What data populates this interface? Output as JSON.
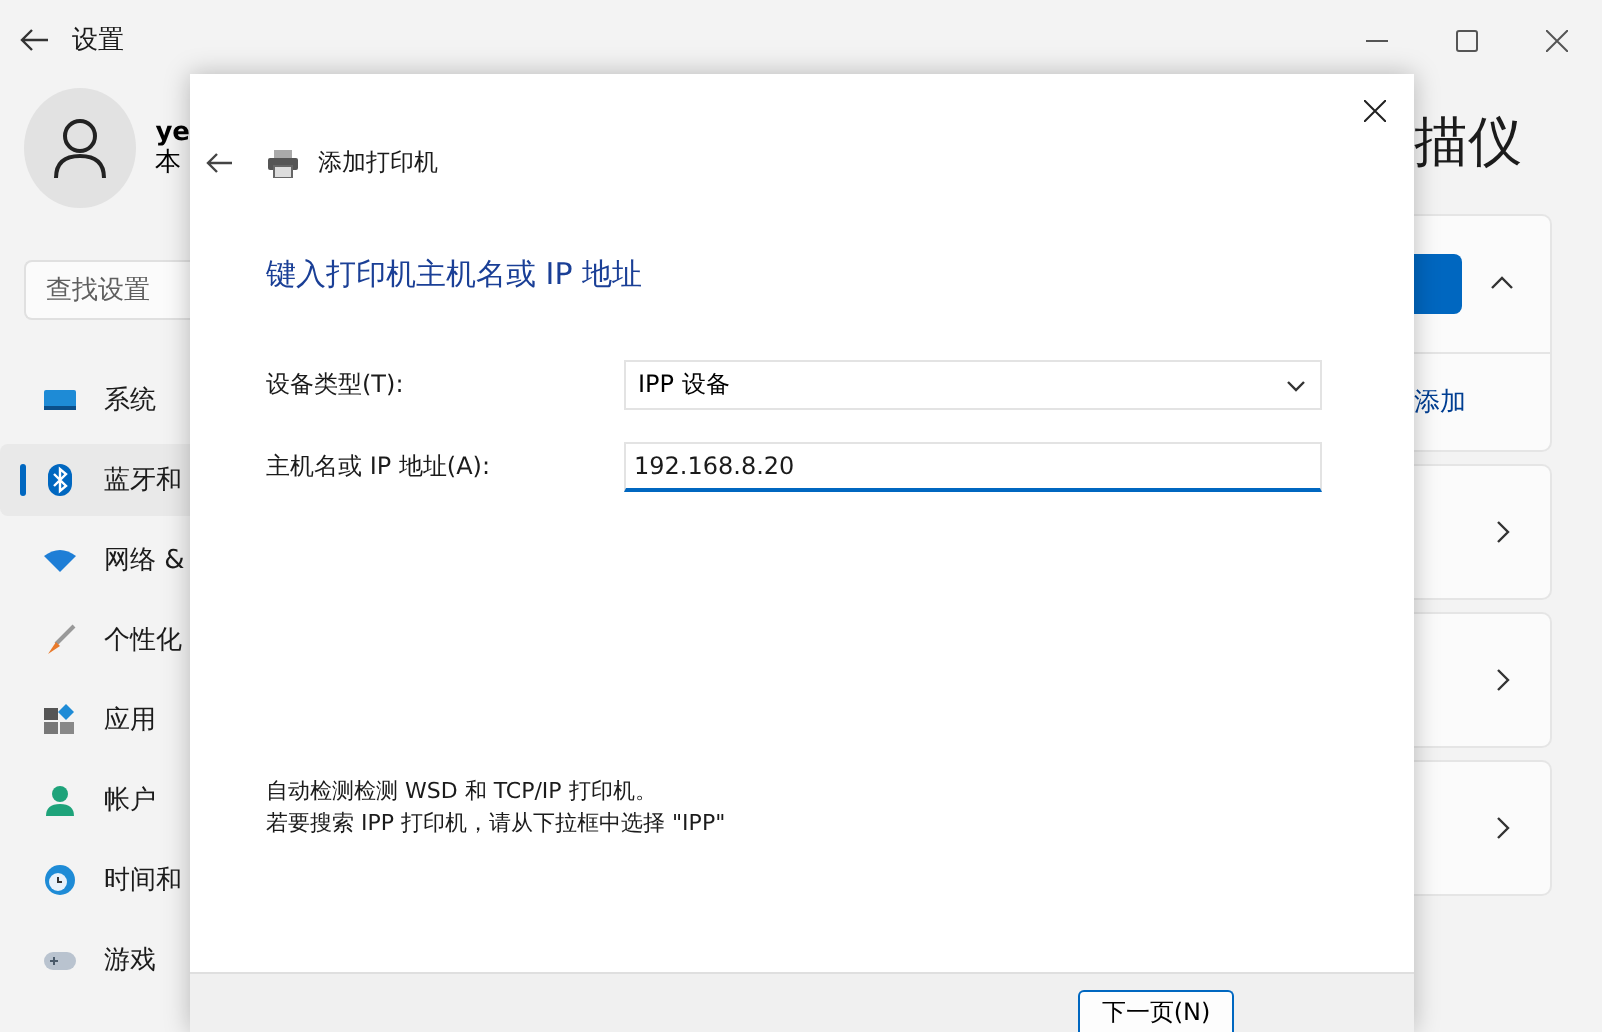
{
  "window": {
    "title": "设置"
  },
  "profile": {
    "name": "ye",
    "subtitle": "本"
  },
  "search": {
    "placeholder": "查找设置"
  },
  "sidebar": {
    "items": [
      {
        "label": "系统",
        "selected": false
      },
      {
        "label": "蓝牙和",
        "selected": true
      },
      {
        "label": "网络 &",
        "selected": false
      },
      {
        "label": "个性化",
        "selected": false
      },
      {
        "label": "应用",
        "selected": false
      },
      {
        "label": "帐户",
        "selected": false
      },
      {
        "label": "时间和",
        "selected": false
      },
      {
        "label": "游戏",
        "selected": false
      }
    ]
  },
  "page": {
    "title": "描仪",
    "cards": [
      {
        "kind": "expanded",
        "link": "添加"
      },
      {
        "kind": "collapsed"
      },
      {
        "kind": "collapsed"
      },
      {
        "kind": "collapsed"
      }
    ]
  },
  "dialog": {
    "title": "添加打印机",
    "heading": "键入打印机主机名或 IP 地址",
    "fields": [
      {
        "kind": "select",
        "label": "设备类型(T):",
        "value": "IPP 设备"
      },
      {
        "kind": "text",
        "label": "主机名或 IP 地址(A):",
        "value": "192.168.8.20"
      }
    ],
    "notes": [
      "自动检测检测 WSD 和 TCP/IP 打印机。",
      "若要搜索 IPP 打印机，请从下拉框中选择 \"IPP\""
    ],
    "buttons": [
      "下一页(N)"
    ]
  }
}
